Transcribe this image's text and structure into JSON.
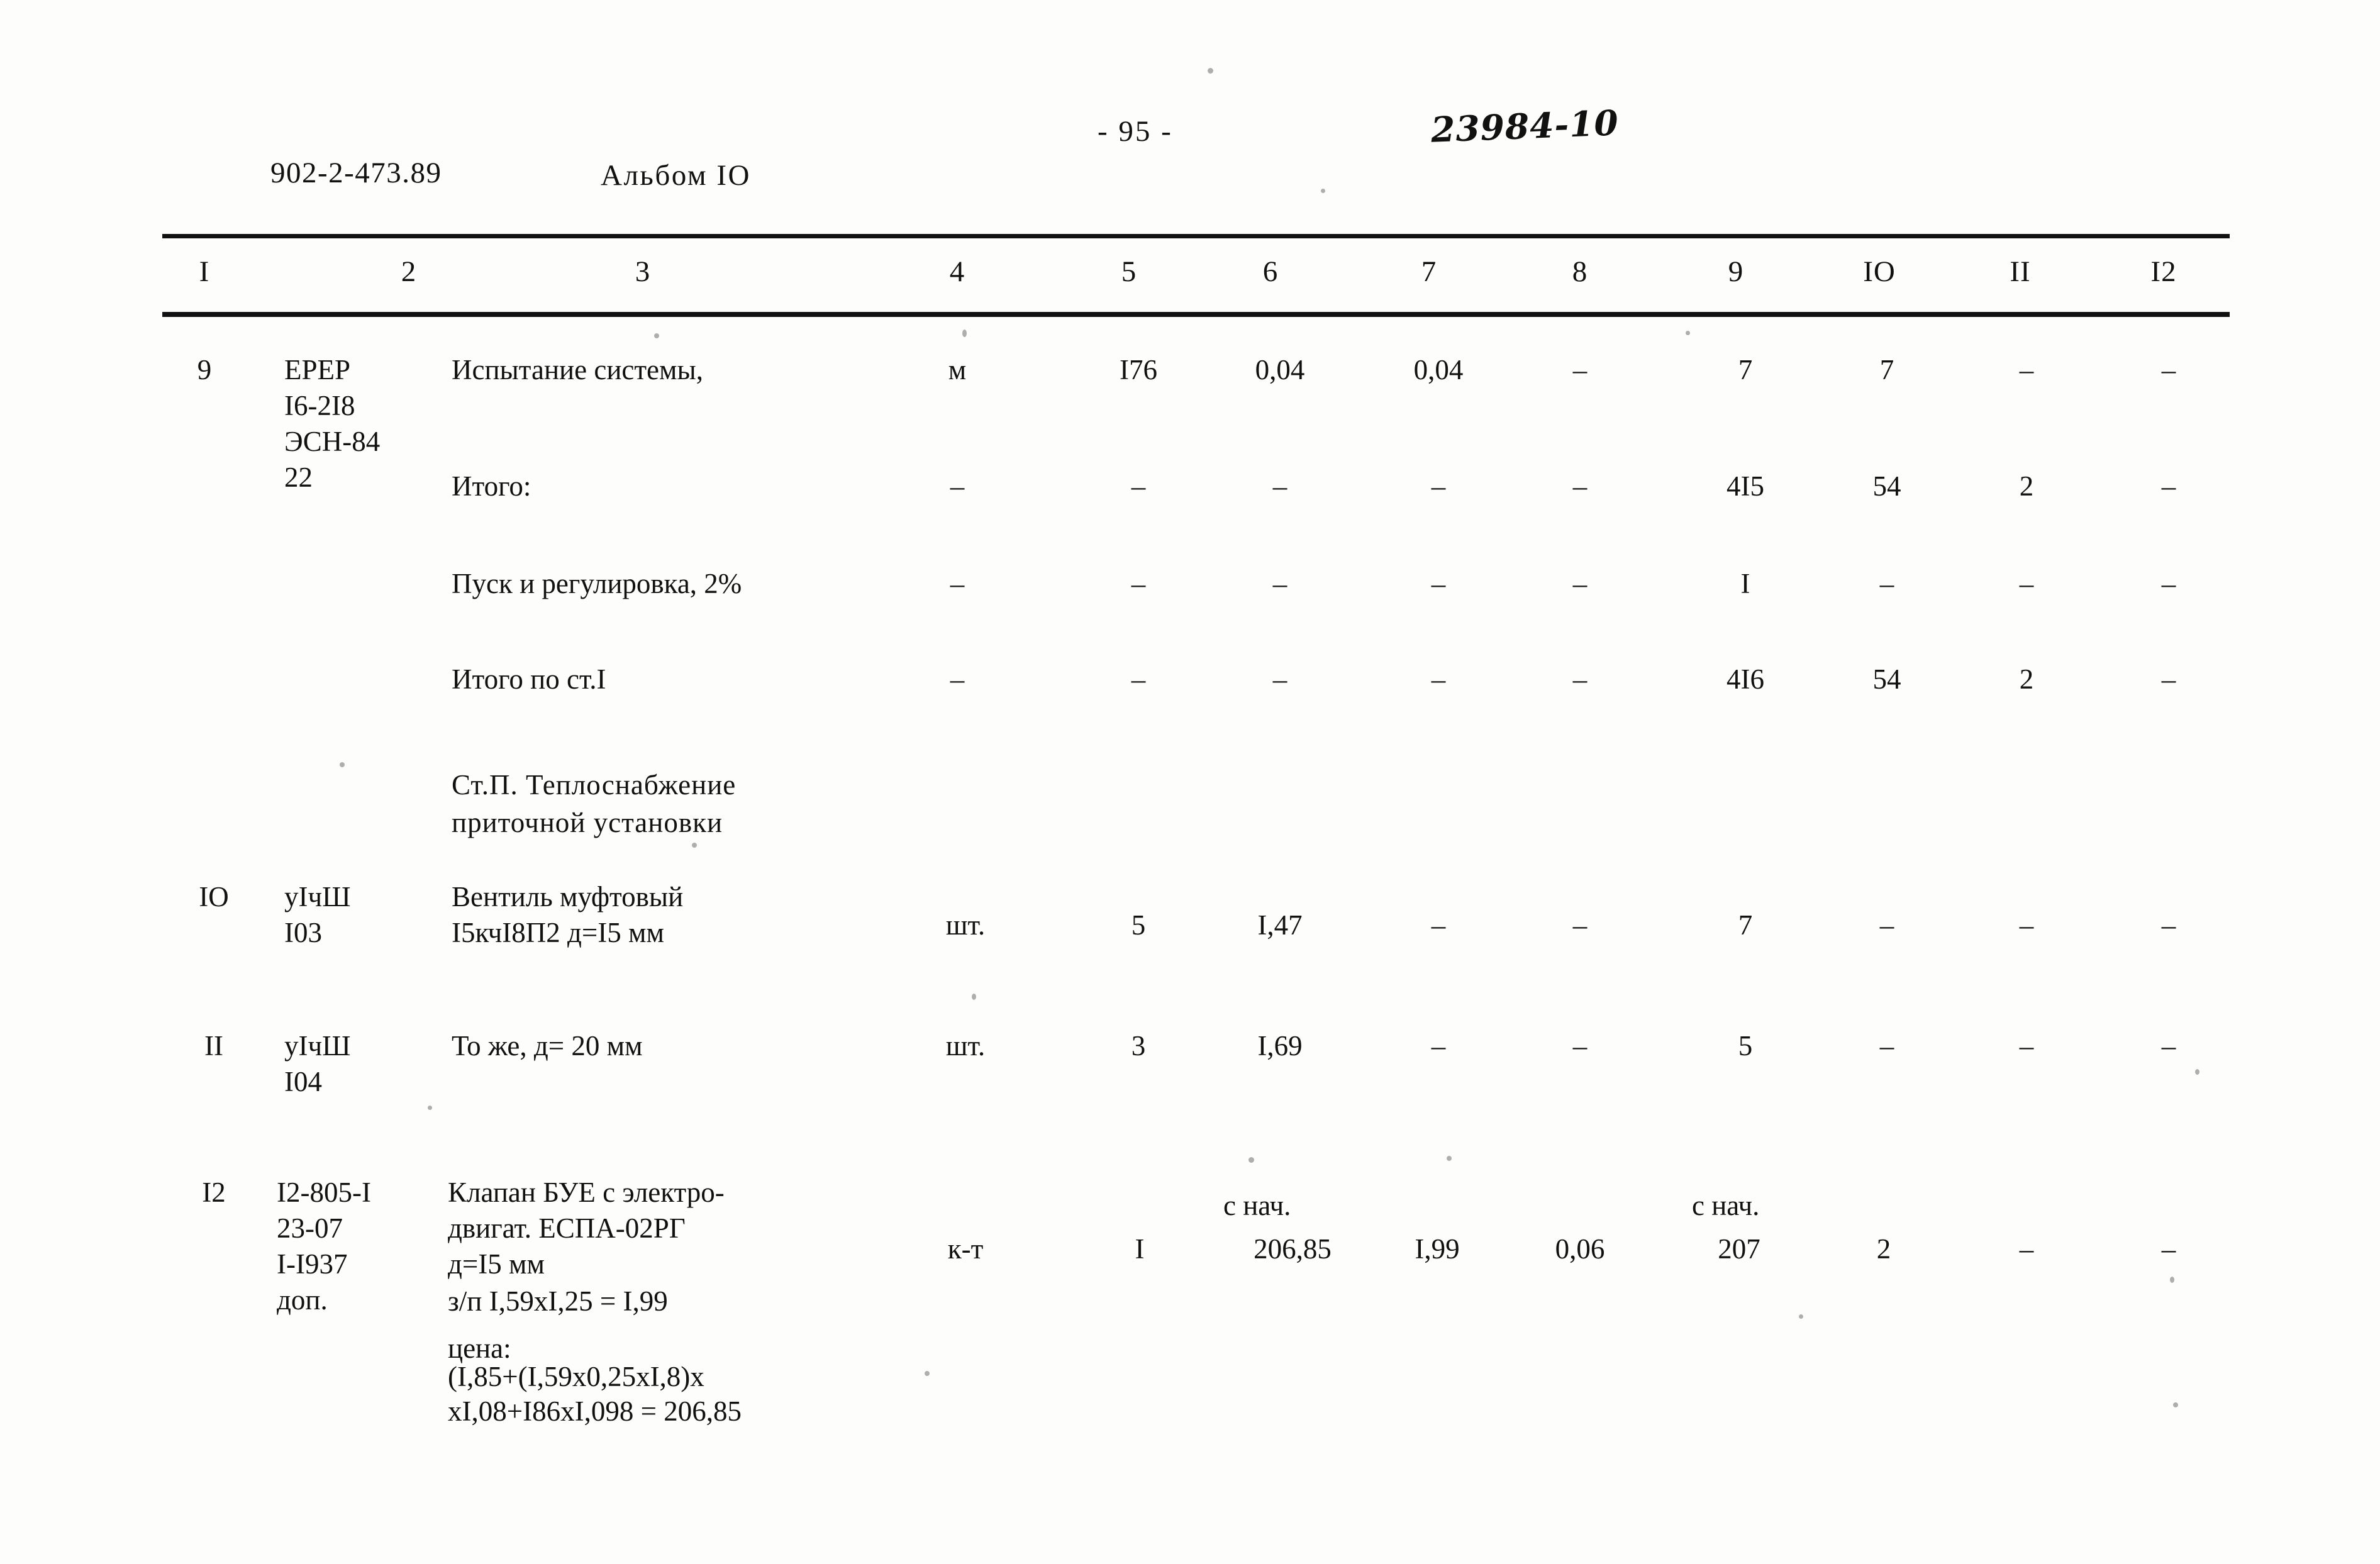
{
  "header": {
    "doc_code": "902-2-473.89",
    "album": "Альбом IO",
    "page_number": "- 95 -",
    "handwritten_mark": "23984-10"
  },
  "table": {
    "column_numbers": [
      "I",
      "2",
      "3",
      "4",
      "5",
      "6",
      "7",
      "8",
      "9",
      "IO",
      "II",
      "I2"
    ],
    "rows": [
      {
        "num": "9",
        "code": "ЕРЕР\nI6-2I8\nЭСН-84\n22",
        "name": "Испытание системы,",
        "unit": "м",
        "c5": "I76",
        "c6": "0,04",
        "c7": "0,04",
        "c8": "–",
        "c9": "7",
        "c10": "7",
        "c11": "–",
        "c12": "–"
      },
      {
        "num": "",
        "code": "",
        "name": "Итого:",
        "unit": "–",
        "c5": "–",
        "c6": "–",
        "c7": "–",
        "c8": "–",
        "c9": "4I5",
        "c10": "54",
        "c11": "2",
        "c12": "–"
      },
      {
        "num": "",
        "code": "",
        "name": "Пуск и регулировка, 2%",
        "unit": "–",
        "c5": "–",
        "c6": "–",
        "c7": "–",
        "c8": "–",
        "c9": "I",
        "c10": "–",
        "c11": "–",
        "c12": "–"
      },
      {
        "num": "",
        "code": "",
        "name": "Итого по ст.I",
        "unit": "–",
        "c5": "–",
        "c6": "–",
        "c7": "–",
        "c8": "–",
        "c9": "4I6",
        "c10": "54",
        "c11": "2",
        "c12": "–"
      },
      {
        "num": "IO",
        "code": "уIчШ\nI03",
        "name": "Вентиль муфтовый\nI5кчI8П2 д=I5 мм",
        "unit": "шт.",
        "c5": "5",
        "c6": "I,47",
        "c7": "–",
        "c8": "–",
        "c9": "7",
        "c10": "–",
        "c11": "–",
        "c12": "–"
      },
      {
        "num": "II",
        "code": "уIчШ\nI04",
        "name": "То же, д= 20 мм",
        "unit": "шт.",
        "c5": "3",
        "c6": "I,69",
        "c7": "–",
        "c8": "–",
        "c9": "5",
        "c10": "–",
        "c11": "–",
        "c12": "–"
      },
      {
        "num": "I2",
        "code": "I2-805-I\n23-07\nI-I937\nдоп.",
        "name": "Клапан БУЕ с электро-\nдвигат. ЕСПА-02РГ\nд=I5 мм",
        "unit": "к-т",
        "c5": "I",
        "c6": "206,85",
        "c7": "I,99",
        "c8": "0,06",
        "c9": "207",
        "c10": "2",
        "c11": "–",
        "c12": "–"
      }
    ],
    "section_heading": "Ст.П. Теплоснабжение\nприточной установки",
    "note_s_nach_c6": "с нач.",
    "note_s_nach_c9": "с нач.",
    "calc_salary": "з/п I,59хI,25 = I,99",
    "calc_price_label": "цена:",
    "calc_price_line1": "(I,85+(I,59х0,25хI,8)х",
    "calc_price_line2": "хI,08+I86хI,098 = 206,85"
  }
}
